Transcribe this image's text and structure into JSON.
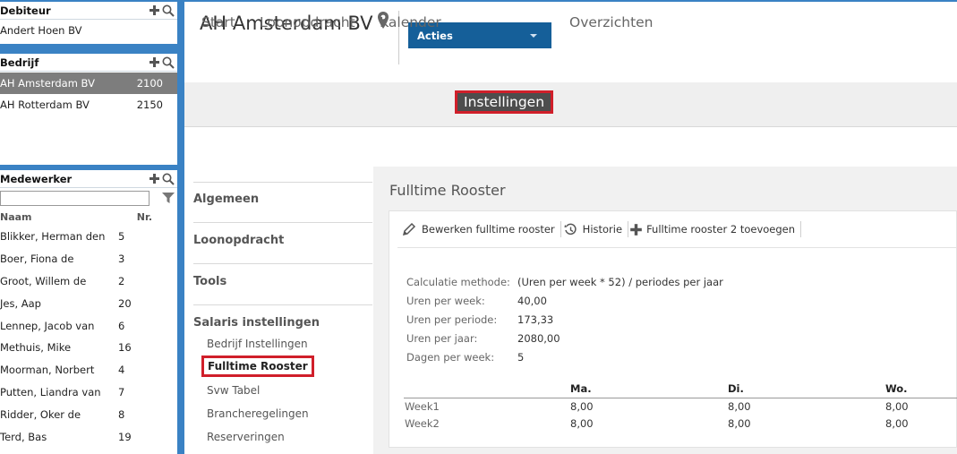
{
  "debiteur": {
    "title": "Debiteur",
    "items": [
      {
        "name": "Andert Hoen BV"
      }
    ]
  },
  "bedrijf": {
    "title": "Bedrijf",
    "items": [
      {
        "name": "AH Amsterdam BV",
        "nr": "2100",
        "selected": true
      },
      {
        "name": "AH Rotterdam BV",
        "nr": "2150",
        "selected": false
      }
    ]
  },
  "medewerker": {
    "title": "Medewerker",
    "filter_value": "",
    "col_name": "Naam",
    "col_nr": "Nr.",
    "items": [
      {
        "name": "Blikker, Herman den",
        "nr": "5"
      },
      {
        "name": "Boer, Fiona de",
        "nr": "3"
      },
      {
        "name": "Groot, Willem de",
        "nr": "2"
      },
      {
        "name": "Jes, Aap",
        "nr": "20"
      },
      {
        "name": "Lennep, Jacob van",
        "nr": "6"
      },
      {
        "name": "Methuis, Mike",
        "nr": "16"
      },
      {
        "name": "Moorman, Norbert",
        "nr": "4"
      },
      {
        "name": "Putten, Liandra van",
        "nr": "7"
      },
      {
        "name": "Ridder, Oker de",
        "nr": "8"
      },
      {
        "name": "Terd, Bas",
        "nr": "19"
      }
    ]
  },
  "header": {
    "title": "AH Amsterdam BV",
    "actions_label": "Acties"
  },
  "tabs": [
    "Start",
    "Loonopdracht",
    "Kalender",
    "Instellingen",
    "Overzichten"
  ],
  "menu": {
    "sections": [
      "Algemeen",
      "Loonopdracht",
      "Tools",
      "Salaris instellingen"
    ],
    "items": [
      "Bedrijf Instellingen",
      "Fulltime Rooster",
      "Svw Tabel",
      "Brancheregelingen",
      "Reserveringen"
    ]
  },
  "content": {
    "title": "Fulltime Rooster",
    "toolbar": {
      "edit": "Bewerken fulltime rooster",
      "history": "Historie",
      "add": "Fulltime rooster 2 toevoegen"
    },
    "info": [
      {
        "label": "Calculatie methode:",
        "value": "(Uren per week * 52) / periodes per jaar"
      },
      {
        "label": "Uren per week:",
        "value": "40,00"
      },
      {
        "label": "Uren per periode:",
        "value": "173,33"
      },
      {
        "label": "Uren per jaar:",
        "value": "2080,00"
      },
      {
        "label": "Dagen per week:",
        "value": "5"
      }
    ],
    "week_headers": [
      "Ma.",
      "Di.",
      "Wo."
    ],
    "weeks": [
      {
        "label": "Week1",
        "values": [
          "8,00",
          "8,00",
          "8,00"
        ]
      },
      {
        "label": "Week2",
        "values": [
          "8,00",
          "8,00",
          "8,00"
        ]
      }
    ]
  },
  "colors": {
    "brand_blue": "#3a82c4",
    "actions_blue": "#155f99",
    "highlight_red": "#d01f2a",
    "selected_gray": "#7d7d7d"
  }
}
